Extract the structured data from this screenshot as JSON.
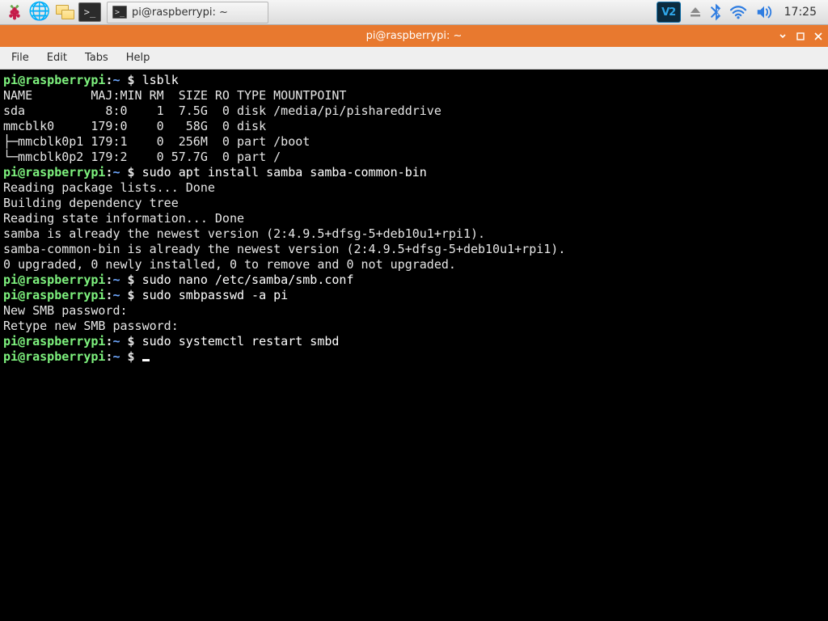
{
  "taskbar": {
    "task_tab_label": "pi@raspberrypi: ~",
    "vnc_label": "V2",
    "clock": "17:25"
  },
  "titlebar": {
    "title": "pi@raspberrypi: ~"
  },
  "menubar": [
    "File",
    "Edit",
    "Tabs",
    "Help"
  ],
  "prompt": {
    "user": "pi",
    "at": "@",
    "host": "raspberrypi",
    "colon": ":",
    "path": "~",
    "dollar": " $ "
  },
  "session": [
    {
      "type": "cmd",
      "text": "lsblk"
    },
    {
      "type": "out",
      "text": "NAME        MAJ:MIN RM  SIZE RO TYPE MOUNTPOINT"
    },
    {
      "type": "out",
      "text": "sda           8:0    1  7.5G  0 disk /media/pi/pishareddrive"
    },
    {
      "type": "out",
      "text": "mmcblk0     179:0    0   58G  0 disk "
    },
    {
      "type": "out",
      "text": "├─mmcblk0p1 179:1    0  256M  0 part /boot"
    },
    {
      "type": "out",
      "text": "└─mmcblk0p2 179:2    0 57.7G  0 part /"
    },
    {
      "type": "cmd",
      "text": "sudo apt install samba samba-common-bin"
    },
    {
      "type": "out",
      "text": "Reading package lists... Done"
    },
    {
      "type": "out",
      "text": "Building dependency tree"
    },
    {
      "type": "out",
      "text": "Reading state information... Done"
    },
    {
      "type": "out",
      "text": "samba is already the newest version (2:4.9.5+dfsg-5+deb10u1+rpi1)."
    },
    {
      "type": "out",
      "text": "samba-common-bin is already the newest version (2:4.9.5+dfsg-5+deb10u1+rpi1)."
    },
    {
      "type": "out",
      "text": "0 upgraded, 0 newly installed, 0 to remove and 0 not upgraded."
    },
    {
      "type": "cmd",
      "text": "sudo nano /etc/samba/smb.conf"
    },
    {
      "type": "cmd",
      "text": "sudo smbpasswd -a pi"
    },
    {
      "type": "out",
      "text": "New SMB password:"
    },
    {
      "type": "out",
      "text": "Retype new SMB password:"
    },
    {
      "type": "cmd",
      "text": "sudo systemctl restart smbd"
    },
    {
      "type": "prompt_only"
    }
  ]
}
